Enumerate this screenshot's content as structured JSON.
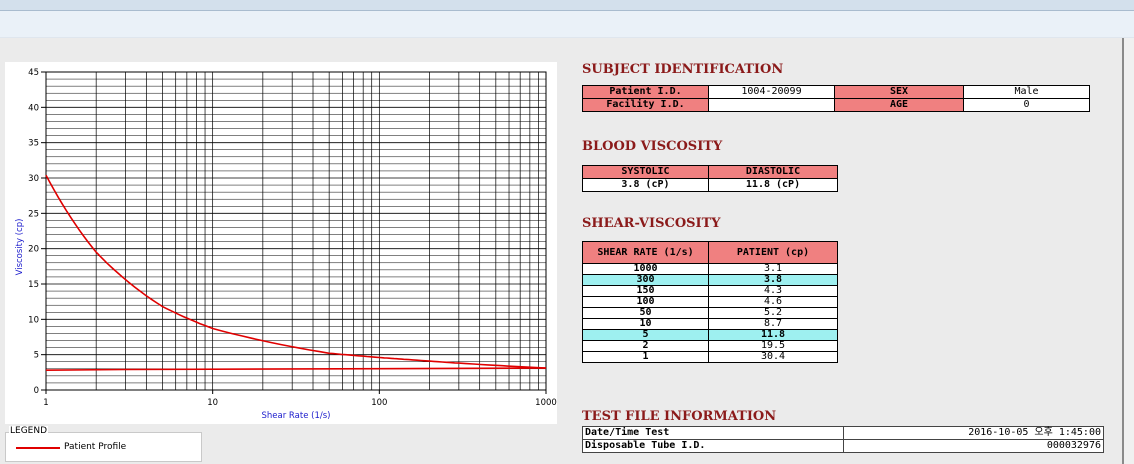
{
  "subject": {
    "title": "SUBJECT IDENTIFICATION",
    "patient_id_label": "Patient I.D.",
    "patient_id": "1004-20099",
    "sex_label": "SEX",
    "sex": "Male",
    "facility_id_label": "Facility I.D.",
    "facility_id": "",
    "age_label": "AGE",
    "age": "0"
  },
  "blood_viscosity": {
    "title": "BLOOD VISCOSITY",
    "systolic_label": "SYSTOLIC",
    "diastolic_label": "DIASTOLIC",
    "systolic": "3.8 (cP)",
    "diastolic": "11.8 (cP)"
  },
  "shear_viscosity": {
    "title": "SHEAR-VISCOSITY",
    "col_shear": "SHEAR RATE (1/s)",
    "col_patient": "PATIENT (cp)",
    "rows": [
      {
        "rate": "1000",
        "value": "3.1",
        "hl": false
      },
      {
        "rate": "300",
        "value": "3.8",
        "hl": true
      },
      {
        "rate": "150",
        "value": "4.3",
        "hl": false
      },
      {
        "rate": "100",
        "value": "4.6",
        "hl": false
      },
      {
        "rate": "50",
        "value": "5.2",
        "hl": false
      },
      {
        "rate": "10",
        "value": "8.7",
        "hl": false
      },
      {
        "rate": "5",
        "value": "11.8",
        "hl": true
      },
      {
        "rate": "2",
        "value": "19.5",
        "hl": false
      },
      {
        "rate": "1",
        "value": "30.4",
        "hl": false
      }
    ]
  },
  "test_file": {
    "title": "TEST FILE INFORMATION",
    "datetime_label": "Date/Time Test",
    "datetime": "2016-10-05  오후 1:45:00",
    "tube_label": "Disposable Tube I.D.",
    "tube": "000032976"
  },
  "legend": {
    "title": "LEGEND",
    "items": [
      {
        "label": "Patient Profile",
        "color": "#e00000"
      }
    ]
  },
  "chart_data": {
    "type": "line",
    "xlabel": "Shear Rate (1/s)",
    "ylabel": "Viscosity (cp)",
    "x_scale": "log",
    "xlim": [
      1,
      1000
    ],
    "ylim": [
      0,
      45
    ],
    "grid": true,
    "x_ticks": [
      "1",
      "10",
      "100",
      "1000"
    ],
    "y_ticks": [
      "0",
      "5",
      "10",
      "15",
      "20",
      "25",
      "30",
      "35",
      "40",
      "45"
    ],
    "series": [
      {
        "name": "Patient Profile",
        "color": "#e00000",
        "x": [
          1,
          2,
          5,
          10,
          50,
          100,
          150,
          300,
          1000
        ],
        "y": [
          30.4,
          19.5,
          11.8,
          8.7,
          5.2,
          4.6,
          4.3,
          3.8,
          3.1
        ]
      }
    ],
    "reference_line": {
      "color": "#e00000",
      "x": [
        1,
        3,
        1000
      ],
      "y": [
        2.8,
        2.9,
        3.1
      ]
    }
  }
}
